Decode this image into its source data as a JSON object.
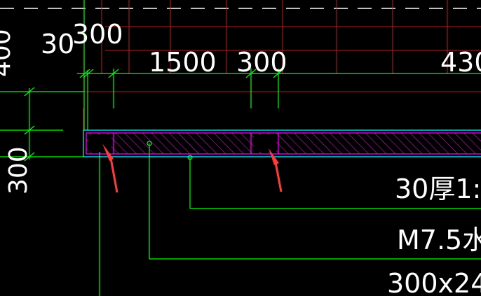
{
  "colors": {
    "background": "#000000",
    "dimension_line": "#00ff00",
    "grid_line": "#b22222",
    "axis_line": "#ff0000",
    "slab_outline": "#00ffff",
    "hatch": "#ff00ff",
    "text": "#ffffff",
    "arrow": "#ff3b3b",
    "dashed_line": "#ffffff"
  },
  "dimensions": {
    "top_30": "30",
    "top_300": "300",
    "top_1500": "1500",
    "top_300b": "300",
    "top_430": "430",
    "left_400": "400",
    "left_300": "300"
  },
  "annotations": {
    "line1": "30厚1:",
    "line2": "M7.5水",
    "line3": "300x24"
  },
  "markers": {
    "arrow_left": "arrow-icon",
    "arrow_right": "arrow-icon"
  }
}
